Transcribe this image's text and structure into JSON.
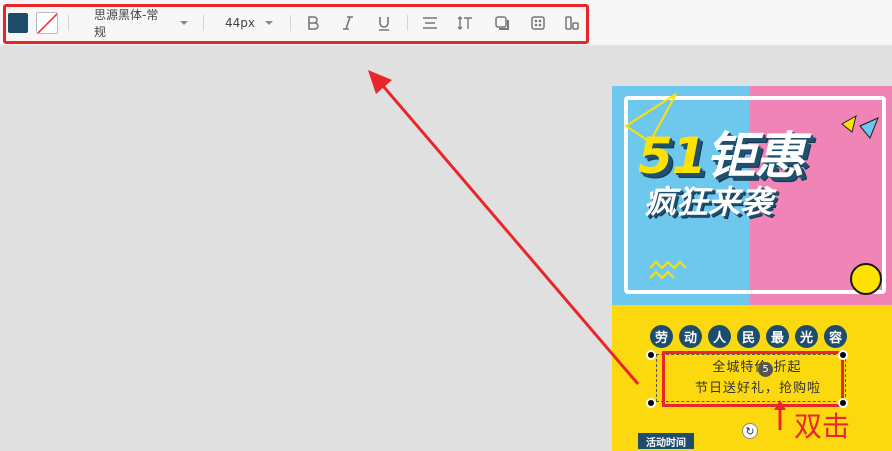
{
  "toolbar": {
    "fill_color": "#1e4d6b",
    "font_family": "思源黑体-常规",
    "font_size": "44px",
    "icons": [
      "bold-icon",
      "italic-icon",
      "underline-icon",
      "align-icon",
      "line-height-icon",
      "shadow-icon",
      "texture-icon",
      "layer-icon"
    ]
  },
  "poster": {
    "headline_number": "51",
    "headline_1": "钜惠",
    "headline_2": "疯狂来袭",
    "chars": [
      "劳",
      "动",
      "人",
      "民",
      "最",
      "光",
      "容"
    ],
    "line1": "全城特价   折起",
    "badge": "5",
    "line2": "节日送好礼，抢购啦",
    "activity_label": "活动时间"
  },
  "annotation": {
    "label": "双击",
    "color": "#e8262b"
  }
}
